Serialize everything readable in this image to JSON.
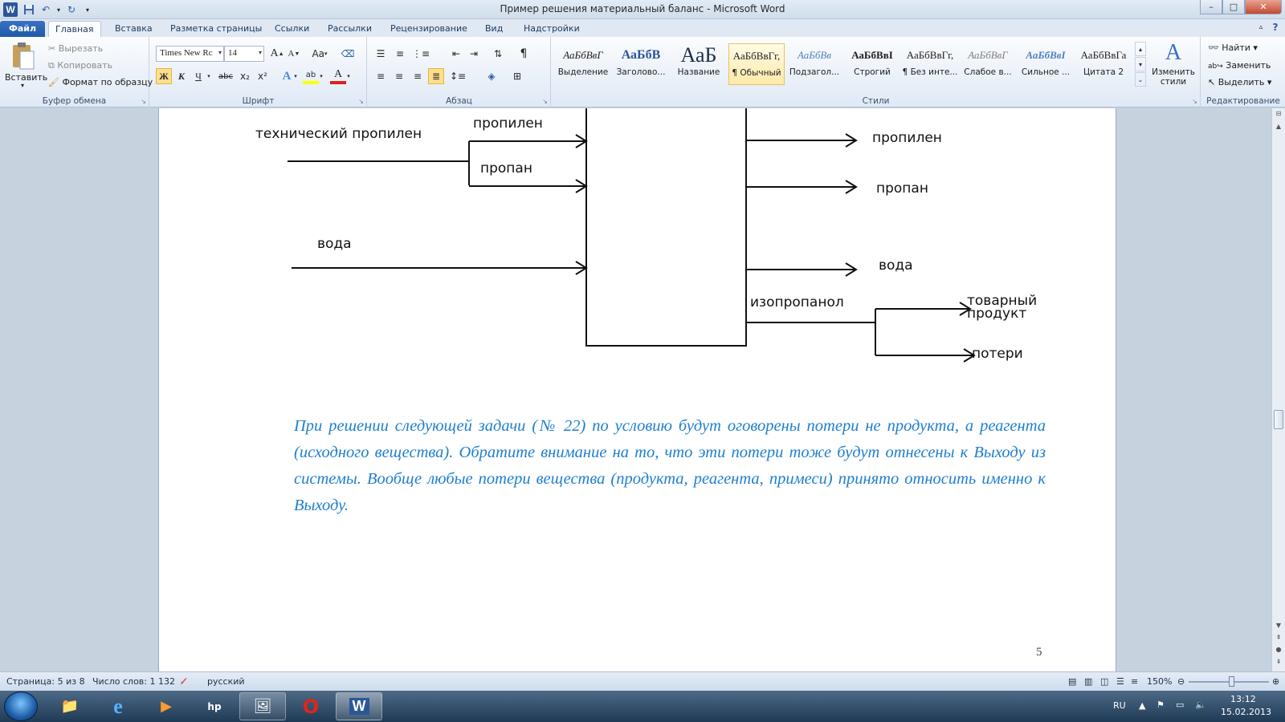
{
  "window": {
    "title": "Пример решения материальный баланс  -  Microsoft Word",
    "minimize": "–",
    "maximize": "□",
    "close": "✕"
  },
  "tabs": [
    {
      "label": "Файл"
    },
    {
      "label": "Главная"
    },
    {
      "label": "Вставка"
    },
    {
      "label": "Разметка страницы"
    },
    {
      "label": "Ссылки"
    },
    {
      "label": "Рассылки"
    },
    {
      "label": "Рецензирование"
    },
    {
      "label": "Вид"
    },
    {
      "label": "Надстройки"
    }
  ],
  "clipboard": {
    "paste": "Вставить",
    "cut": "Вырезать",
    "copy": "Копировать",
    "format_painter": "Формат по образцу",
    "group_label": "Буфер обмена"
  },
  "font": {
    "name": "Times New Rc",
    "size": "14",
    "bold": "Ж",
    "italic": "К",
    "underline": "Ч",
    "strike": "abc",
    "subscript": "x₂",
    "superscript": "x²",
    "grow": "A",
    "shrink": "A",
    "case": "Aa",
    "group_label": "Шрифт"
  },
  "paragraph": {
    "pilcrow": "¶",
    "group_label": "Абзац"
  },
  "styles": {
    "items": [
      {
        "sample": "АаБбВвГ",
        "name": "Выделение"
      },
      {
        "sample": "АаБбВ",
        "name": "Заголово..."
      },
      {
        "sample": "АаБ",
        "name": "Название"
      },
      {
        "sample": "АаБбВвГг,",
        "name": "¶ Обычный"
      },
      {
        "sample": "АаБбВв",
        "name": "Подзагол..."
      },
      {
        "sample": "АаБбВвІ",
        "name": "Строгий"
      },
      {
        "sample": "АаБбВвГг,",
        "name": "¶ Без инте..."
      },
      {
        "sample": "АаБбВвГ",
        "name": "Слабое в..."
      },
      {
        "sample": "АаБбВвІ",
        "name": "Сильное ..."
      },
      {
        "sample": "АаБбВвГа",
        "name": "Цитата 2"
      }
    ],
    "change_styles": "Изменить стили",
    "group_label": "Стили"
  },
  "editing": {
    "find": "Найти",
    "replace": "Заменить",
    "select": "Выделить",
    "group_label": "Редактирование"
  },
  "diagram": {
    "labels": {
      "tech_propylene": "технический пропилен",
      "in_propylene": "пропилен",
      "in_propane": "пропан",
      "in_water": "вода",
      "out_propylene": "пропилен",
      "out_propane": "пропан",
      "out_water": "вода",
      "isopropanol": "изопропанол",
      "product_line1": "товарный",
      "product_line2": "продукт",
      "losses": "потери"
    }
  },
  "document": {
    "note": "При решении следующей задачи (№ 22) по условию будут оговорены потери не продукта, а реагента (исходного вещества). Обратите внимание на то, что эти потери тоже будут отнесены к Выходу из системы. Вообще любые потери вещества (продукта, реагента, примеси) принято относить именно к Выходу.",
    "page_number": "5"
  },
  "statusbar": {
    "page": "Страница: 5 из 8",
    "words": "Число слов: 1 132",
    "language": "русский",
    "zoom": "150%",
    "zoom_level_percent": 150
  },
  "taskbar": {
    "lang": "RU",
    "time": "13:12",
    "date": "15.02.2013"
  },
  "colors": {
    "note_text": "#1e7fd0",
    "file_tab": "#2b5797"
  }
}
